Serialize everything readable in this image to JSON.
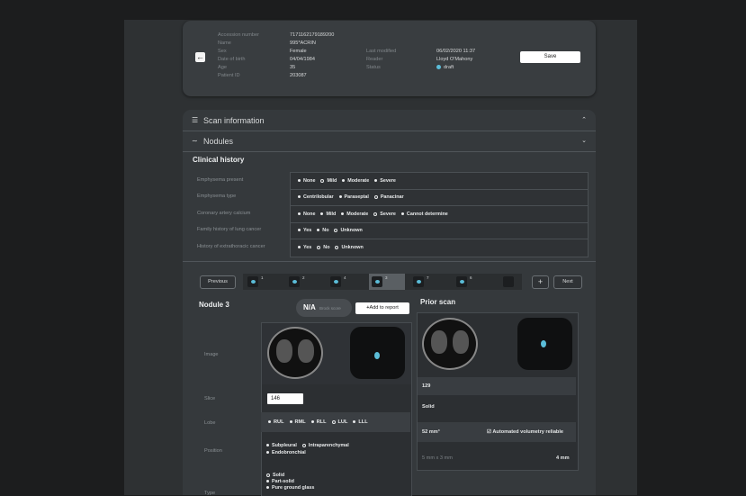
{
  "header": {
    "labels": [
      "Accession number",
      "Name",
      "Sex",
      "Date of birth",
      "Age",
      "Patient ID"
    ],
    "values": [
      "7171162179189200",
      "995*ACRIN",
      "Female",
      "04/04/1984",
      "35",
      "203087"
    ],
    "meta_labels": [
      "Last modified",
      "Reader",
      "Status"
    ],
    "last_modified": "06/02/2020 11:37",
    "reader": "Lloyd O'Mahony",
    "status": "draft",
    "status_color": "#5bbdd8",
    "save_label": "Save"
  },
  "sections": {
    "scan_info": "Scan information",
    "nodules": "Nodules"
  },
  "clinical": {
    "title": "Clinical history",
    "rows": [
      {
        "label": "Emphysema present",
        "options": [
          {
            "t": "None",
            "f": true
          },
          {
            "t": "Mild",
            "f": false
          },
          {
            "t": "Moderate",
            "f": true
          },
          {
            "t": "Severe",
            "f": true
          }
        ]
      },
      {
        "label": "Emphysema type",
        "options": [
          {
            "t": "Centrilobular",
            "f": true
          },
          {
            "t": "Paraseptal",
            "f": true
          },
          {
            "t": "Panacinar",
            "f": false
          }
        ]
      },
      {
        "label": "Coronary artery calcium",
        "options": [
          {
            "t": "None",
            "f": true
          },
          {
            "t": "Mild",
            "f": true
          },
          {
            "t": "Moderate",
            "f": true
          },
          {
            "t": "Severe",
            "f": false
          },
          {
            "t": "Cannot determine",
            "f": true
          }
        ]
      },
      {
        "label": "Family history of lung cancer",
        "options": [
          {
            "t": "Yes",
            "f": true
          },
          {
            "t": "No",
            "f": true
          },
          {
            "t": "Unknown",
            "f": false
          }
        ]
      },
      {
        "label": "History of extrathoracic cancer",
        "options": [
          {
            "t": "Yes",
            "f": true
          },
          {
            "t": "No",
            "f": false
          },
          {
            "t": "Unknown",
            "f": false
          }
        ]
      }
    ]
  },
  "nav": {
    "previous": "Previous",
    "next": "Next",
    "add": "+",
    "thumbnails": [
      "1",
      "2",
      "4",
      "3",
      "7",
      "6",
      ""
    ]
  },
  "nodule": {
    "title": "Nodule 3",
    "score": "N/A",
    "score_label": "Brock score",
    "add_to_report": "Add to report",
    "row_labels": [
      "Image",
      "Slice",
      "Lobe",
      "Position",
      "Type"
    ],
    "slice": "146",
    "lobes": [
      {
        "t": "RUL",
        "f": true
      },
      {
        "t": "RML",
        "f": true
      },
      {
        "t": "RLL",
        "f": true
      },
      {
        "t": "LUL",
        "f": false
      },
      {
        "t": "LLL",
        "f": true
      }
    ],
    "positions": [
      {
        "t": "Subpleural",
        "f": true
      },
      {
        "t": "Intraparenchymal",
        "f": false
      },
      {
        "t": "Endobronchial",
        "f": true
      }
    ],
    "types": [
      {
        "t": "Solid",
        "f": false
      },
      {
        "t": "Part-solid",
        "f": true
      },
      {
        "t": "Pure ground glass",
        "f": true
      }
    ]
  },
  "prior": {
    "title": "Prior scan",
    "slice": "129",
    "type": "Solid",
    "volume": "52 mm³",
    "volumetry": "Automated volumetry reliable",
    "dims": "5 mm x 3 mm",
    "diameter": "4 mm"
  }
}
